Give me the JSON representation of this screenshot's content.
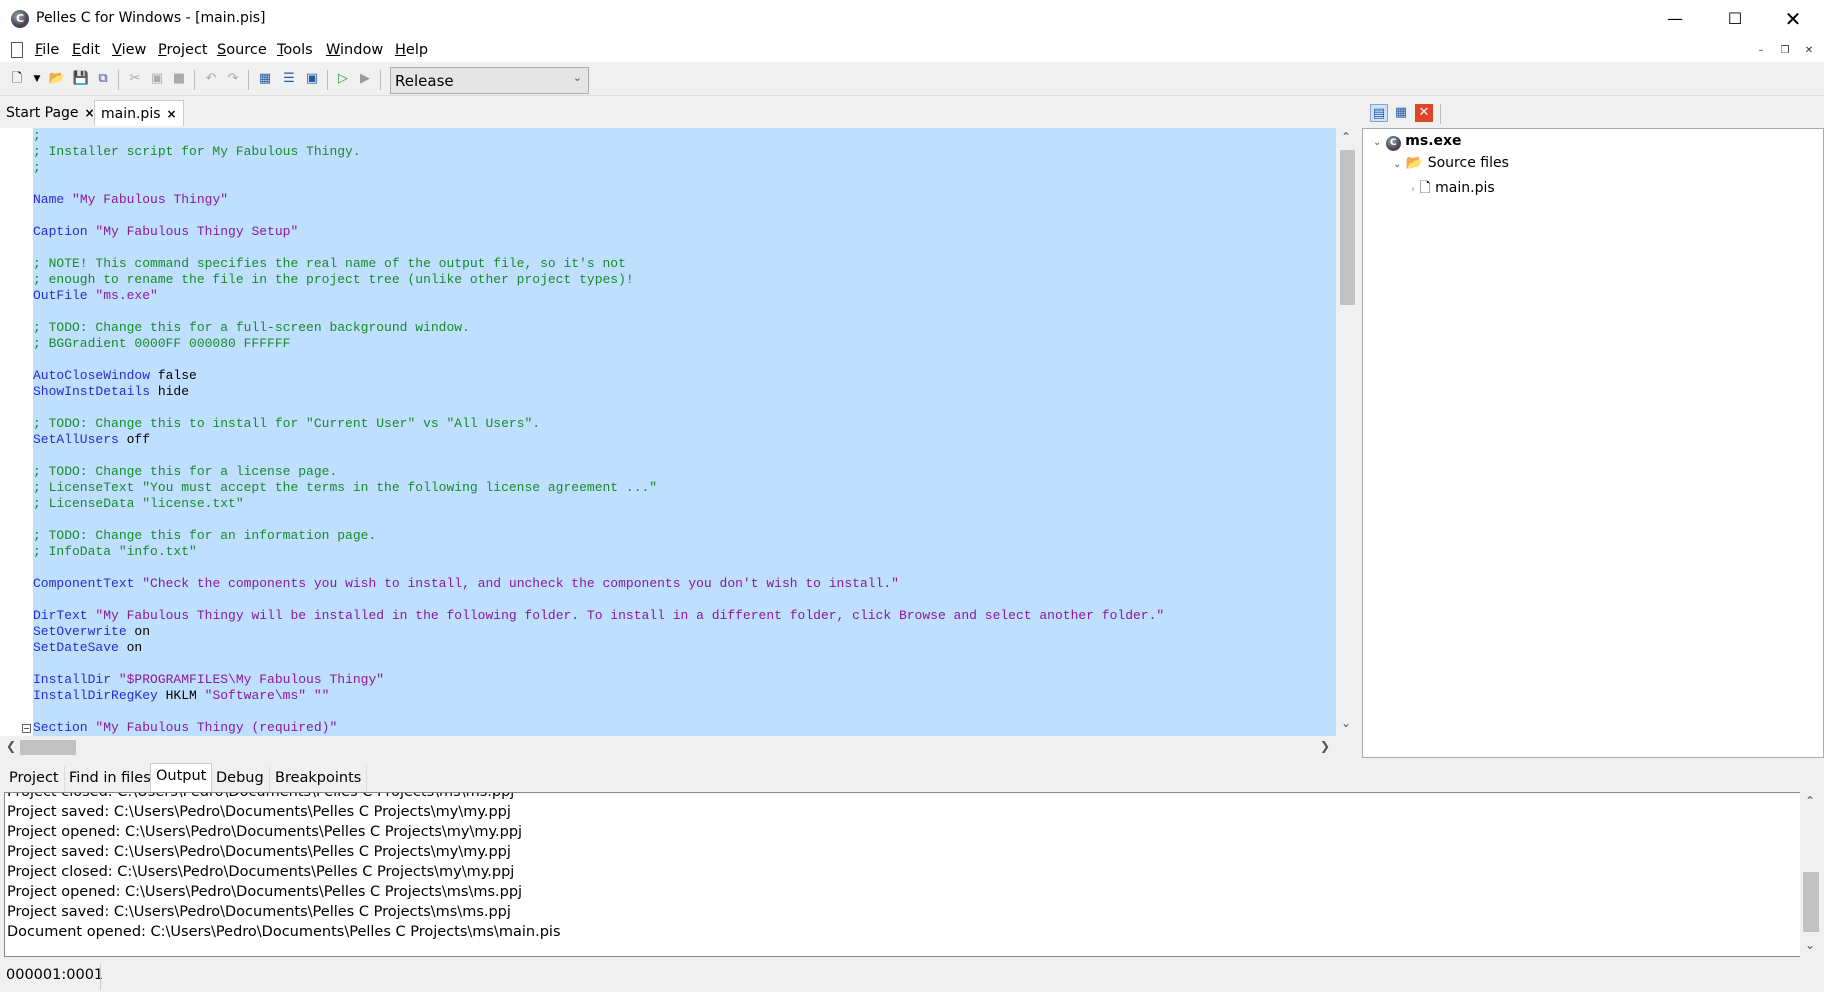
{
  "window": {
    "title": "Pelles C for Windows - [main.pis]",
    "minimize_icon": "minimize-icon",
    "maximize_icon": "maximize-icon",
    "close_icon": "close-icon"
  },
  "menu": [
    "File",
    "Edit",
    "View",
    "Project",
    "Source",
    "Tools",
    "Window",
    "Help"
  ],
  "toolbar": {
    "configuration": "Release",
    "icons": [
      "new-file-icon",
      "dropdown-arrow-icon",
      "open-folder-icon",
      "save-icon",
      "save-all-icon",
      "cut-icon",
      "copy-icon",
      "paste-icon",
      "undo-icon",
      "redo-icon",
      "compile-icon",
      "build-icon",
      "execute-window-icon",
      "go-debug-icon",
      "run-icon"
    ]
  },
  "doc_tabs": [
    {
      "label": "Start Page",
      "active": false
    },
    {
      "label": "main.pis",
      "active": true
    }
  ],
  "editor": {
    "selection_color": "#bfdfff",
    "colors": {
      "keyword": "#2a2ad0",
      "string": "#8a1a9a",
      "comment": "#1a8a2a"
    },
    "lines": [
      [
        [
          "cm",
          ";"
        ]
      ],
      [
        [
          "cm",
          "; Installer script for My Fabulous Thingy."
        ]
      ],
      [
        [
          "cm",
          ";"
        ]
      ],
      [],
      [
        [
          "kw",
          "Name"
        ],
        [
          "pl",
          " "
        ],
        [
          "str",
          "\"My Fabulous Thingy\""
        ]
      ],
      [],
      [
        [
          "kw",
          "Caption"
        ],
        [
          "pl",
          " "
        ],
        [
          "str",
          "\"My Fabulous Thingy Setup\""
        ]
      ],
      [],
      [
        [
          "cm",
          "; NOTE! This command specifies the real name of the output file, so it's not"
        ]
      ],
      [
        [
          "cm",
          "; enough to rename the file in the project tree (unlike other project types)!"
        ]
      ],
      [
        [
          "kw",
          "OutFile"
        ],
        [
          "pl",
          " "
        ],
        [
          "str",
          "\"ms.exe\""
        ]
      ],
      [],
      [
        [
          "cm",
          "; TODO: Change this for a full-screen background window."
        ]
      ],
      [
        [
          "cm",
          "; BGGradient 0000FF 000080 FFFFFF"
        ]
      ],
      [],
      [
        [
          "kw",
          "AutoCloseWindow"
        ],
        [
          "pl",
          " false"
        ]
      ],
      [
        [
          "kw",
          "ShowInstDetails"
        ],
        [
          "pl",
          " hide"
        ]
      ],
      [],
      [
        [
          "cm",
          "; TODO: Change this to install for \"Current User\" vs \"All Users\"."
        ]
      ],
      [
        [
          "kw",
          "SetAllUsers"
        ],
        [
          "pl",
          " off"
        ]
      ],
      [],
      [
        [
          "cm",
          "; TODO: Change this for a license page."
        ]
      ],
      [
        [
          "cm",
          "; LicenseText \"You must accept the terms in the following license agreement ...\""
        ]
      ],
      [
        [
          "cm",
          "; LicenseData \"license.txt\""
        ]
      ],
      [],
      [
        [
          "cm",
          "; TODO: Change this for an information page."
        ]
      ],
      [
        [
          "cm",
          "; InfoData \"info.txt\""
        ]
      ],
      [],
      [
        [
          "kw",
          "ComponentText"
        ],
        [
          "pl",
          " "
        ],
        [
          "str",
          "\"Check the components you wish to install, and uncheck the components you don't wish to install.\""
        ]
      ],
      [],
      [
        [
          "kw",
          "DirText"
        ],
        [
          "pl",
          " "
        ],
        [
          "str",
          "\"My Fabulous Thingy will be installed in the following folder. To install in a different folder, click Browse and select another folder.\""
        ]
      ],
      [
        [
          "kw",
          "SetOverwrite"
        ],
        [
          "pl",
          " on"
        ]
      ],
      [
        [
          "kw",
          "SetDateSave"
        ],
        [
          "pl",
          " on"
        ]
      ],
      [],
      [
        [
          "kw",
          "InstallDir"
        ],
        [
          "pl",
          " "
        ],
        [
          "str",
          "\"$PROGRAMFILES\\My Fabulous Thingy\""
        ]
      ],
      [
        [
          "kw",
          "InstallDirRegKey"
        ],
        [
          "pl",
          " HKLM "
        ],
        [
          "str",
          "\"Software\\ms\" \"\""
        ]
      ],
      [],
      [
        [
          "kw",
          "Section"
        ],
        [
          "pl",
          " "
        ],
        [
          "str",
          "\"My Fabulous Thingy (required)\""
        ]
      ]
    ]
  },
  "project_tree": {
    "root": "ms.exe",
    "folder": "Source files",
    "file": "main.pis"
  },
  "bottom_tabs": [
    {
      "label": "Project"
    },
    {
      "label": "Find in files"
    },
    {
      "label": "Output",
      "active": true
    },
    {
      "label": "Debug"
    },
    {
      "label": "Breakpoints"
    }
  ],
  "output": [
    "Project closed: C:\\Users\\Pedro\\Documents\\Pelles C Projects\\ms\\ms.ppj",
    "Project saved: C:\\Users\\Pedro\\Documents\\Pelles C Projects\\my\\my.ppj",
    "Project opened: C:\\Users\\Pedro\\Documents\\Pelles C Projects\\my\\my.ppj",
    "Project saved: C:\\Users\\Pedro\\Documents\\Pelles C Projects\\my\\my.ppj",
    "Project closed: C:\\Users\\Pedro\\Documents\\Pelles C Projects\\my\\my.ppj",
    "Project opened: C:\\Users\\Pedro\\Documents\\Pelles C Projects\\ms\\ms.ppj",
    "Project saved: C:\\Users\\Pedro\\Documents\\Pelles C Projects\\ms\\ms.ppj",
    "Document opened: C:\\Users\\Pedro\\Documents\\Pelles C Projects\\ms\\main.pis"
  ],
  "status": {
    "position": "000001:0001"
  }
}
